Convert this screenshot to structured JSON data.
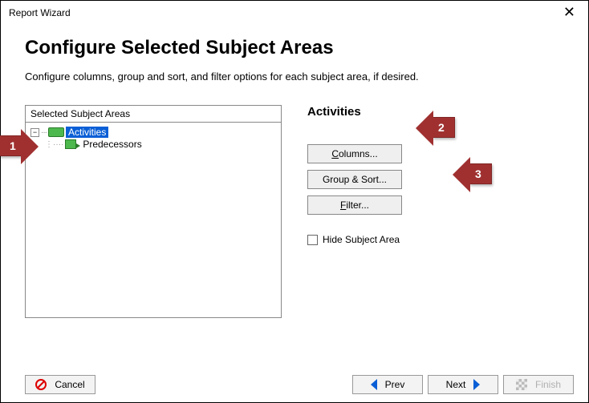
{
  "window": {
    "title": "Report Wizard"
  },
  "page": {
    "heading": "Configure Selected Subject Areas",
    "subtitle": "Configure columns, group and sort, and filter options for each subject area, if desired."
  },
  "tree": {
    "header": "Selected Subject Areas",
    "nodes": [
      {
        "label": "Activities",
        "selected": true
      },
      {
        "label": "Predecessors",
        "selected": false
      }
    ]
  },
  "right": {
    "title": "Activities",
    "buttons": {
      "columns": "Columns...",
      "group_sort": "Group & Sort...",
      "filter": "Filter..."
    },
    "hide_checkbox_label": "Hide Subject Area",
    "hide_checked": false
  },
  "footer": {
    "cancel": "Cancel",
    "prev": "Prev",
    "next": "Next",
    "finish": "Finish"
  },
  "annotations": {
    "one": "1",
    "two": "2",
    "three": "3"
  }
}
